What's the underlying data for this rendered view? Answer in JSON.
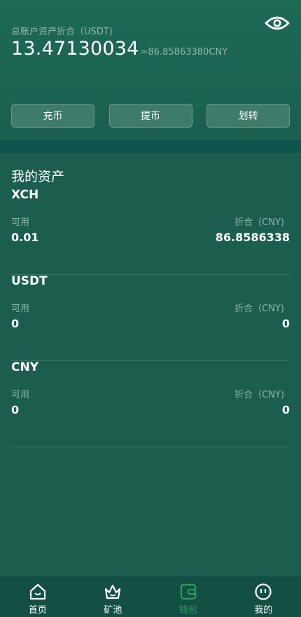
{
  "header": {
    "total_label": "总账户资产折合（USDT)",
    "total_value": "13.47130034",
    "total_cny": "≈86.85863380CNY"
  },
  "actions": {
    "deposit": "充币",
    "withdraw": "提币",
    "transfer": "划转"
  },
  "assets_section": {
    "title": "我的资产",
    "items": [
      {
        "name": "XCH",
        "avail_label": "可用",
        "fold_label": "折合（CNY)",
        "avail_value": "0.01",
        "fold_value": "86.8586338"
      },
      {
        "name": "USDT",
        "avail_label": "可用",
        "fold_label": "折合（CNY)",
        "avail_value": "0",
        "fold_value": "0"
      },
      {
        "name": "CNY",
        "avail_label": "可用",
        "fold_label": "折合（CNY)",
        "avail_value": "0",
        "fold_value": "0"
      }
    ]
  },
  "tabbar": {
    "items": [
      {
        "label": "首页",
        "icon": "home-icon"
      },
      {
        "label": "矿池",
        "icon": "crown-icon"
      },
      {
        "label": "钱包",
        "icon": "wallet-icon",
        "active": true
      },
      {
        "label": "我的",
        "icon": "profile-face-icon"
      }
    ]
  },
  "colors": {
    "background": "#1b5e4d",
    "divider_band": "#11544d",
    "tabbar": "#144f44",
    "active_tab": "#27a05a",
    "muted_text": "#8fb8ab"
  }
}
